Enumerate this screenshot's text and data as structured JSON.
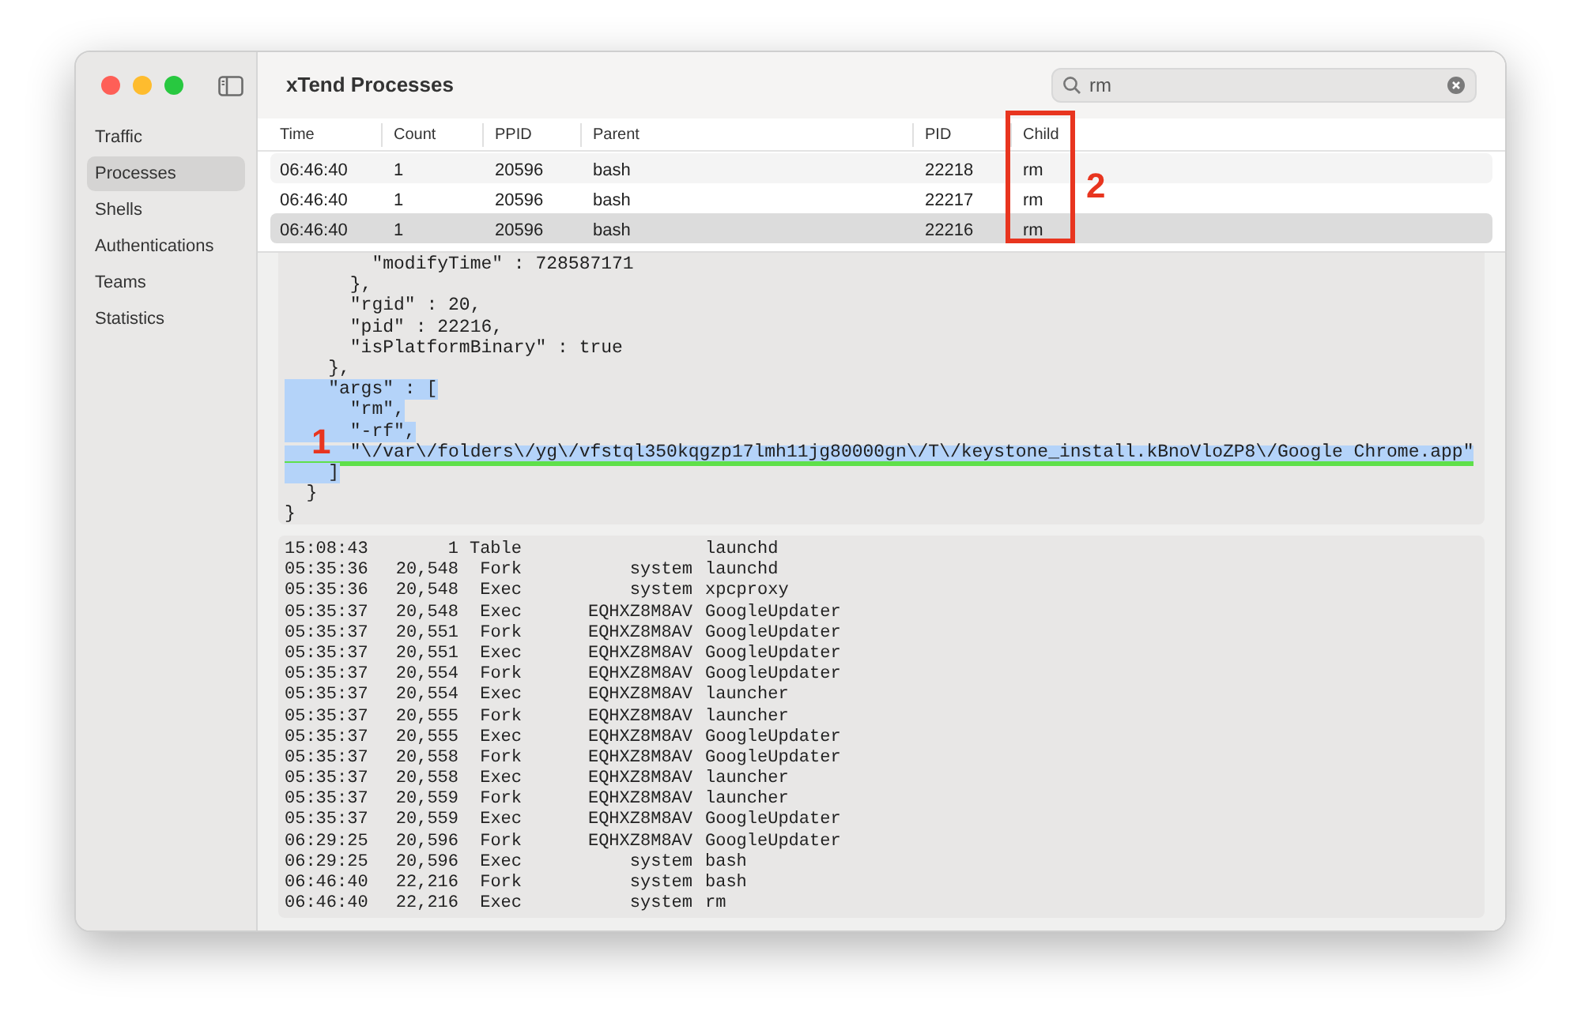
{
  "window": {
    "title": "xTend Processes"
  },
  "search": {
    "value": "rm"
  },
  "sidebar": {
    "items": [
      {
        "label": "Traffic",
        "selected": false
      },
      {
        "label": "Processes",
        "selected": true
      },
      {
        "label": "Shells",
        "selected": false
      },
      {
        "label": "Authentications",
        "selected": false
      },
      {
        "label": "Teams",
        "selected": false
      },
      {
        "label": "Statistics",
        "selected": false
      }
    ]
  },
  "table": {
    "columns": [
      "Time",
      "Count",
      "PPID",
      "Parent",
      "PID",
      "Child"
    ],
    "rows": [
      {
        "cells": [
          "06:46:40",
          "1",
          "20596",
          "bash",
          "22218",
          "rm"
        ],
        "selected": false
      },
      {
        "cells": [
          "06:46:40",
          "1",
          "20596",
          "bash",
          "22217",
          "rm"
        ],
        "selected": false
      },
      {
        "cells": [
          "06:46:40",
          "1",
          "20596",
          "bash",
          "22216",
          "rm"
        ],
        "selected": true
      }
    ]
  },
  "details": {
    "lines": [
      {
        "text": "        \"modifyTime\" : 728587171",
        "highlighted": false,
        "underlined": false
      },
      {
        "text": "      },",
        "highlighted": false,
        "underlined": false
      },
      {
        "text": "      \"rgid\" : 20,",
        "highlighted": false,
        "underlined": false
      },
      {
        "text": "      \"pid\" : 22216,",
        "highlighted": false,
        "underlined": false
      },
      {
        "text": "      \"isPlatformBinary\" : true",
        "highlighted": false,
        "underlined": false
      },
      {
        "text": "    },",
        "highlighted": false,
        "underlined": false
      },
      {
        "text": "    \"args\" : [",
        "highlighted": true,
        "underlined": false
      },
      {
        "text": "      \"rm\",",
        "highlighted": true,
        "underlined": false
      },
      {
        "text": "      \"-rf\",",
        "highlighted": true,
        "underlined": false
      },
      {
        "text": "      \"\\/var\\/folders\\/yg\\/vfstql350kqgzp17lmh11jg80000gn\\/T\\/keystone_install.kBnoVloZP8\\/Google Chrome.app\"",
        "highlighted": true,
        "underlined": true
      },
      {
        "text": "    ]",
        "highlighted": true,
        "underlined": false
      },
      {
        "text": "  }",
        "highlighted": false,
        "underlined": false
      },
      {
        "text": "}",
        "highlighted": false,
        "underlined": false
      }
    ]
  },
  "log": {
    "rows": [
      [
        "15:08:43",
        "1",
        "Table",
        "",
        "launchd"
      ],
      [
        "05:35:36",
        "20,548",
        "Fork",
        "system",
        "launchd"
      ],
      [
        "05:35:36",
        "20,548",
        "Exec",
        "system",
        "xpcproxy"
      ],
      [
        "05:35:37",
        "20,548",
        "Exec",
        "EQHXZ8M8AV",
        "GoogleUpdater"
      ],
      [
        "05:35:37",
        "20,551",
        "Fork",
        "EQHXZ8M8AV",
        "GoogleUpdater"
      ],
      [
        "05:35:37",
        "20,551",
        "Exec",
        "EQHXZ8M8AV",
        "GoogleUpdater"
      ],
      [
        "05:35:37",
        "20,554",
        "Fork",
        "EQHXZ8M8AV",
        "GoogleUpdater"
      ],
      [
        "05:35:37",
        "20,554",
        "Exec",
        "EQHXZ8M8AV",
        "launcher"
      ],
      [
        "05:35:37",
        "20,555",
        "Fork",
        "EQHXZ8M8AV",
        "launcher"
      ],
      [
        "05:35:37",
        "20,555",
        "Exec",
        "EQHXZ8M8AV",
        "GoogleUpdater"
      ],
      [
        "05:35:37",
        "20,558",
        "Fork",
        "EQHXZ8M8AV",
        "GoogleUpdater"
      ],
      [
        "05:35:37",
        "20,558",
        "Exec",
        "EQHXZ8M8AV",
        "launcher"
      ],
      [
        "05:35:37",
        "20,559",
        "Fork",
        "EQHXZ8M8AV",
        "launcher"
      ],
      [
        "05:35:37",
        "20,559",
        "Exec",
        "EQHXZ8M8AV",
        "GoogleUpdater"
      ],
      [
        "06:29:25",
        "20,596",
        "Fork",
        "EQHXZ8M8AV",
        "GoogleUpdater"
      ],
      [
        "06:29:25",
        "20,596",
        "Exec",
        "system",
        "bash"
      ],
      [
        "06:46:40",
        "22,216",
        "Fork",
        "system",
        "bash"
      ],
      [
        "06:46:40",
        "22,216",
        "Exec",
        "system",
        "rm"
      ]
    ]
  },
  "annotations": [
    {
      "label": "1"
    },
    {
      "label": "2"
    }
  ]
}
